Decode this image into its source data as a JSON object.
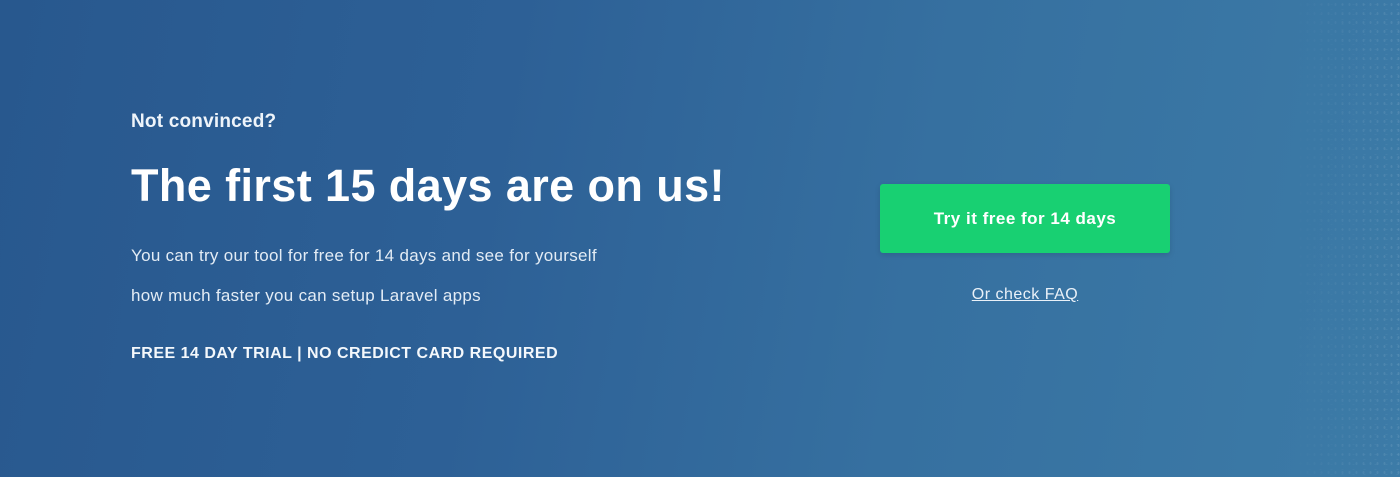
{
  "cta": {
    "eyebrow": "Not convinced?",
    "headline": "The first 15 days are on us!",
    "description_line1": "You can try our tool for free for 14 days and see for yourself",
    "description_line2": "how much faster you can setup Laravel apps",
    "trial_note": "FREE 14 DAY TRIAL | NO CREDICT CARD REQUIRED",
    "button_label": "Try it free for 14 days",
    "faq_link": "Or check FAQ"
  },
  "colors": {
    "background_start": "#28588e",
    "background_end": "#3c7ba7",
    "button": "#18d072",
    "text": "#ffffff"
  }
}
